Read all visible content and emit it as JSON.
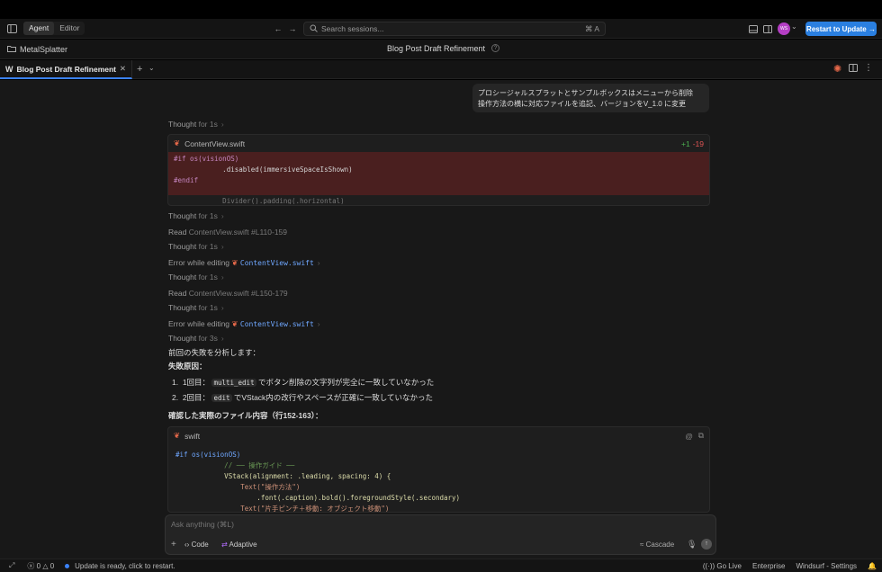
{
  "titlebar": {
    "modes": [
      "Agent",
      "Editor"
    ],
    "active_mode": "Agent",
    "search_placeholder": "Search sessions...",
    "search_shortcut": "⌘ A",
    "avatar_text": "WS",
    "update_label": "Restart to Update →"
  },
  "breadcrumb": {
    "folder": "MetalSplatter",
    "center_title": "Blog Post Draft Refinement"
  },
  "tab": {
    "label": "Blog Post Draft Refinement"
  },
  "user_message": {
    "line1": "プロシージャルスプラットとサンプルボックスはメニューから削除",
    "line2": "操作方法の横に対応ファイルを追記、バージョンをV_1.0 に変更"
  },
  "steps": {
    "thought1": {
      "label": "Thought",
      "detail": "for 1s"
    },
    "diff_card": {
      "file": "ContentView.swift",
      "added": "+1",
      "removed": "-19",
      "lines": [
        "#if os(visionOS)",
        "            .disabled(immersiveSpaceIsShown)",
        "#endif",
        "",
        "            Divider().padding(.horizontal)"
      ]
    },
    "thought2": {
      "label": "Thought",
      "detail": "for 1s"
    },
    "read1": {
      "label": "Read",
      "detail": "ContentView.swift #L110-159"
    },
    "thought3": {
      "label": "Thought",
      "detail": "for 1s"
    },
    "error1": {
      "label": "Error while editing",
      "file": "ContentView.swift"
    },
    "thought4": {
      "label": "Thought",
      "detail": "for 1s"
    },
    "read2": {
      "label": "Read",
      "detail": "ContentView.swift #L150-179"
    },
    "thought5": {
      "label": "Thought",
      "detail": "for 1s"
    },
    "error2": {
      "label": "Error while editing",
      "file": "ContentView.swift"
    },
    "thought6": {
      "label": "Thought",
      "detail": "for 3s"
    }
  },
  "analysis": {
    "intro": "前回の失敗を分析します：",
    "cause_heading": "失敗原因：",
    "items": [
      {
        "num": "1.",
        "pre": "1回目：",
        "code": "multi_edit",
        "post": "でボタン削除の文字列が完全に一致していなかった"
      },
      {
        "num": "2.",
        "pre": "2回目：",
        "code": "edit",
        "post": "でVStack内の改行やスペースが正確に一致していなかった"
      }
    ],
    "confirm_heading": "確認した実際のファイル内容（行152-163）："
  },
  "code_card": {
    "lang": "swift",
    "lines": [
      "#if os(visionOS)",
      "            // ── 操作ガイド ──",
      "            VStack(alignment: .leading, spacing: 4) {",
      "                Text(\"操作方法\")",
      "                    .font(.caption).bold().foregroundStyle(.secondary)",
      "                Text(\"片手ピンチ＋移動: オブジェクト移動\")"
    ]
  },
  "input": {
    "placeholder": "Ask anything (⌘L)",
    "code_label": "Code",
    "adaptive_label": "Adaptive",
    "cascade_label": "Cascade"
  },
  "statusbar": {
    "errors": "0",
    "warnings": "0",
    "update_msg": "Update is ready, click to restart.",
    "golive": "Go Live",
    "enterprise": "Enterprise",
    "settings": "Windsurf - Settings"
  }
}
